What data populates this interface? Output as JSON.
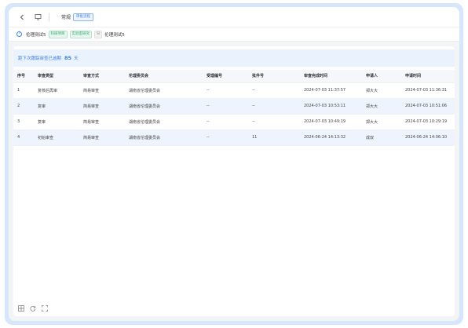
{
  "topbar": {
    "title": "常规",
    "badge": "审批流程"
  },
  "infobar": {
    "project_name": "伦理测试5",
    "tags": [
      "科研项目",
      "实验室研究"
    ],
    "tag_gray": "SI",
    "project_name_2": "伦理测试5"
  },
  "deadline": {
    "label": "距下次跟踪审查已逾期",
    "days": "85",
    "unit": "天"
  },
  "table": {
    "headers": [
      "序号",
      "审查类型",
      "审查方式",
      "伦理委员会",
      "受理编号",
      "批件号",
      "审查完成时间",
      "申请人",
      "申请时间"
    ],
    "rows": [
      [
        "1",
        "复核后再审",
        "简易审查",
        "湖南省伦理委员会",
        "--",
        "--",
        "2024-07-03 11:37:57",
        "郑大大",
        "2024-07-03 11:36:31"
      ],
      [
        "2",
        "复审",
        "简易审查",
        "湖南省伦理委员会",
        "--",
        "--",
        "2024-07-03 10:53:11",
        "郑大大",
        "2024-07-03 10:51:06"
      ],
      [
        "3",
        "复审",
        "简易审查",
        "湖南省伦理委员会",
        "--",
        "--",
        "2024-07-03 10:49:19",
        "郑大大",
        "2024-07-03 10:29:19"
      ],
      [
        "4",
        "初始审查",
        "简易审查",
        "湖南省伦理委员会",
        "--",
        "11",
        "2024-06-24 14:13:32",
        "成双",
        "2024-06-24 14:06:10"
      ]
    ]
  },
  "icons": {
    "back": "chevron-left-icon",
    "monitor": "monitor-icon",
    "info": "info-icon",
    "grid": "grid-icon",
    "refresh": "refresh-icon",
    "fullscreen": "fullscreen-icon"
  },
  "colors": {
    "accent": "#3d7fe0",
    "frame": "#d6e6fb",
    "row_alt": "#eef4fd",
    "tag_green": "#2fa86b"
  }
}
